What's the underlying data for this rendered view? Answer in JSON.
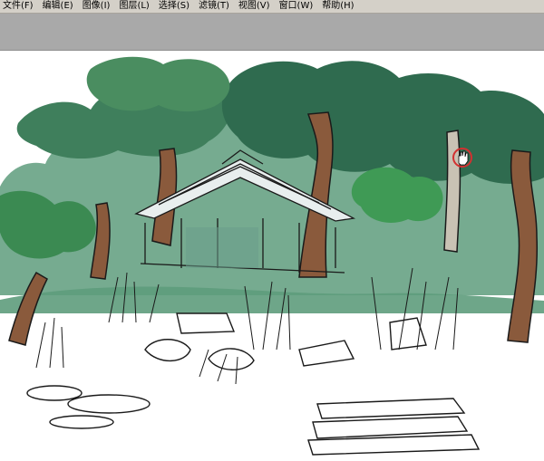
{
  "menu": {
    "items": [
      "文件(F)",
      "编辑(E)",
      "图像(I)",
      "图层(L)",
      "选择(S)",
      "滤镜(T)",
      "视图(V)",
      "窗口(W)",
      "帮助(H)"
    ]
  },
  "canvas": {
    "subject": "hand-drawn garden pavilion sketch",
    "cursor": "hand-icon"
  },
  "colors": {
    "menubar_bg": "#d4d0c8",
    "toolbar_bg": "#a9a9a9",
    "foliage_dark": "#2f6b4f",
    "foliage_light": "#5e9c7c",
    "trunk_brown": "#8a5a3c",
    "cursor_ring": "#d33030"
  }
}
